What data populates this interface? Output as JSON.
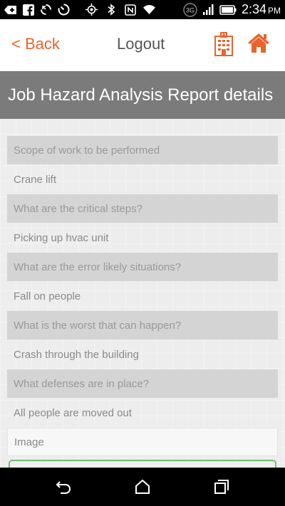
{
  "status_bar": {
    "time": "2:34",
    "ampm": "PM",
    "network": "3G",
    "icons": [
      "add-icon",
      "facebook-icon",
      "sync-icon",
      "timer-icon",
      "gps-icon",
      "bluetooth-icon",
      "nfc-icon",
      "wifi-icon",
      "network-3g-icon",
      "signal-icon",
      "battery-icon"
    ]
  },
  "header": {
    "back_label": "< Back",
    "logout_label": "Logout",
    "accent_color": "#e8642c"
  },
  "title": "Job Hazard Analysis Report details",
  "fields": [
    {
      "question": "Scope of work to be performed",
      "answer": "Crane lift"
    },
    {
      "question": "What are the critical steps?",
      "answer": "Picking up hvac unit"
    },
    {
      "question": "What are the error likely situations?",
      "answer": "Fall on people"
    },
    {
      "question": "What is the worst that can happen?",
      "answer": "Crash through the building"
    },
    {
      "question": "What defenses are in place?",
      "answer": "All people are moved out"
    }
  ],
  "image_label": "Image",
  "nav": [
    "back-nav-icon",
    "home-nav-icon",
    "recents-nav-icon"
  ]
}
